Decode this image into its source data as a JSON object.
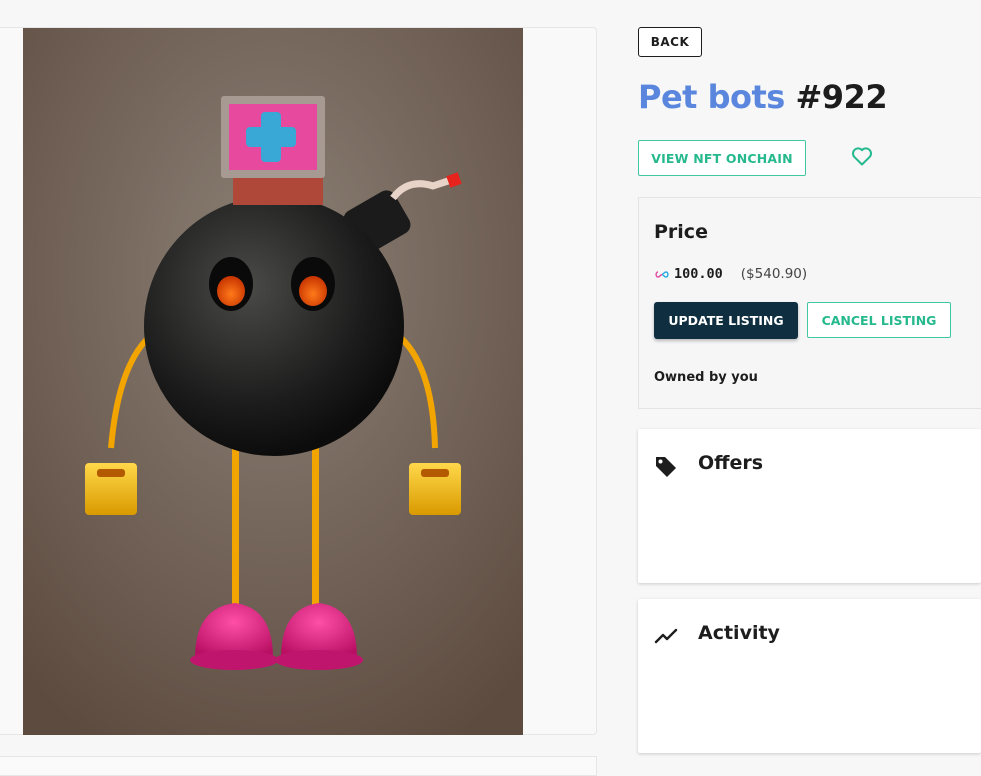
{
  "nav": {
    "back_label": "BACK"
  },
  "nft": {
    "collection": "Pet bots",
    "number": "#922",
    "view_onchain_label": "VIEW NFT ONCHAIN",
    "favorite_icon": "heart-outline-icon"
  },
  "price": {
    "label": "Price",
    "currency_icon": "infinity-icon",
    "amount": "100.00",
    "usd": "($540.90)",
    "update_label": "UPDATE LISTING",
    "cancel_label": "CANCEL LISTING",
    "owner_text": "Owned by you"
  },
  "offers": {
    "title": "Offers",
    "icon": "tag-icon"
  },
  "activity": {
    "title": "Activity",
    "icon": "trending-icon"
  },
  "colors": {
    "accent_green": "#25b98d",
    "collection_blue": "#5a87dd",
    "dark_button": "#0f2f40"
  }
}
